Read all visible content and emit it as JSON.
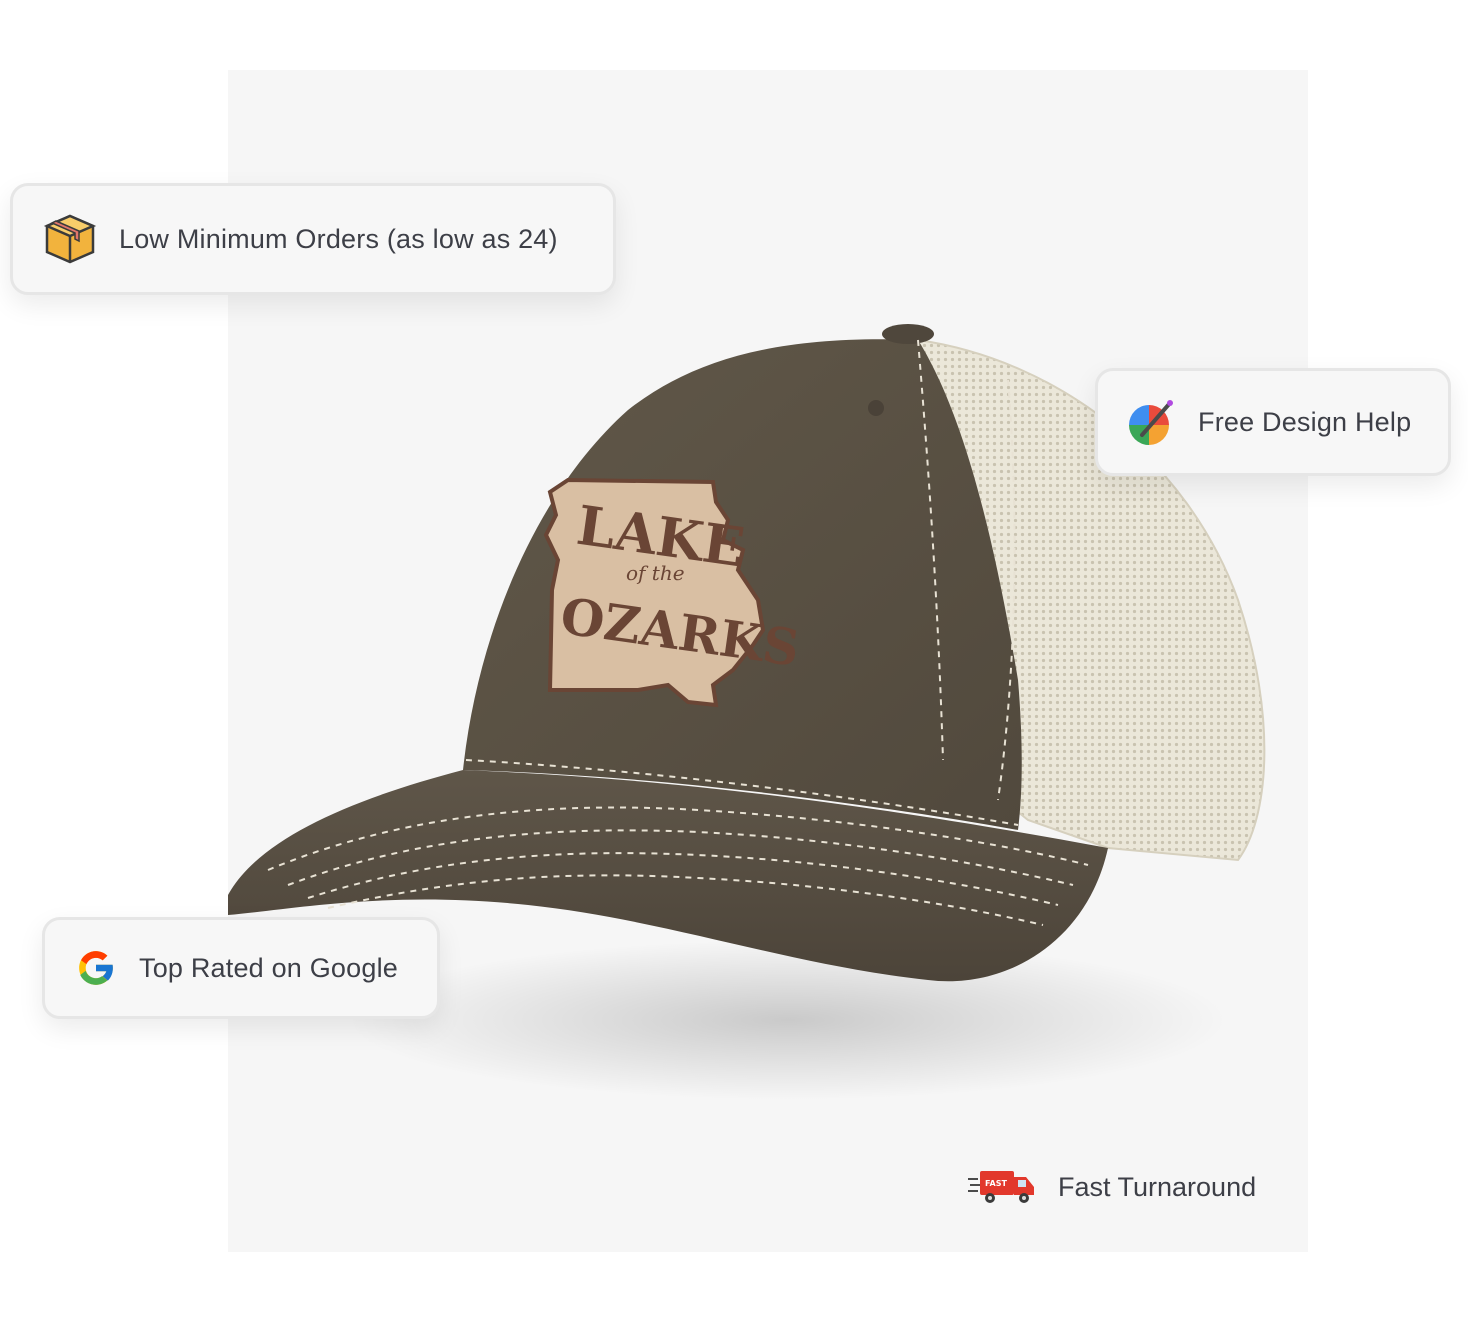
{
  "features": {
    "orders": {
      "label": "Low Minimum Orders (as low as 24)",
      "icon": "package-box-icon"
    },
    "design": {
      "label": "Free Design Help",
      "icon": "paint-palette-icon"
    },
    "google": {
      "label": "Top Rated on Google",
      "icon": "google-logo-icon"
    },
    "turnaround": {
      "label": "Fast Turnaround",
      "icon": "fast-delivery-truck-icon"
    }
  },
  "product": {
    "patch_text_line1": "LAKE",
    "patch_text_line2": "of the",
    "patch_text_line3": "OZARKS",
    "colors": {
      "crown": "#5b5347",
      "mesh": "#ebe7d9",
      "patch": "#d9bfa3",
      "patch_text": "#6a4535",
      "stitch": "#e8e2d4"
    }
  }
}
